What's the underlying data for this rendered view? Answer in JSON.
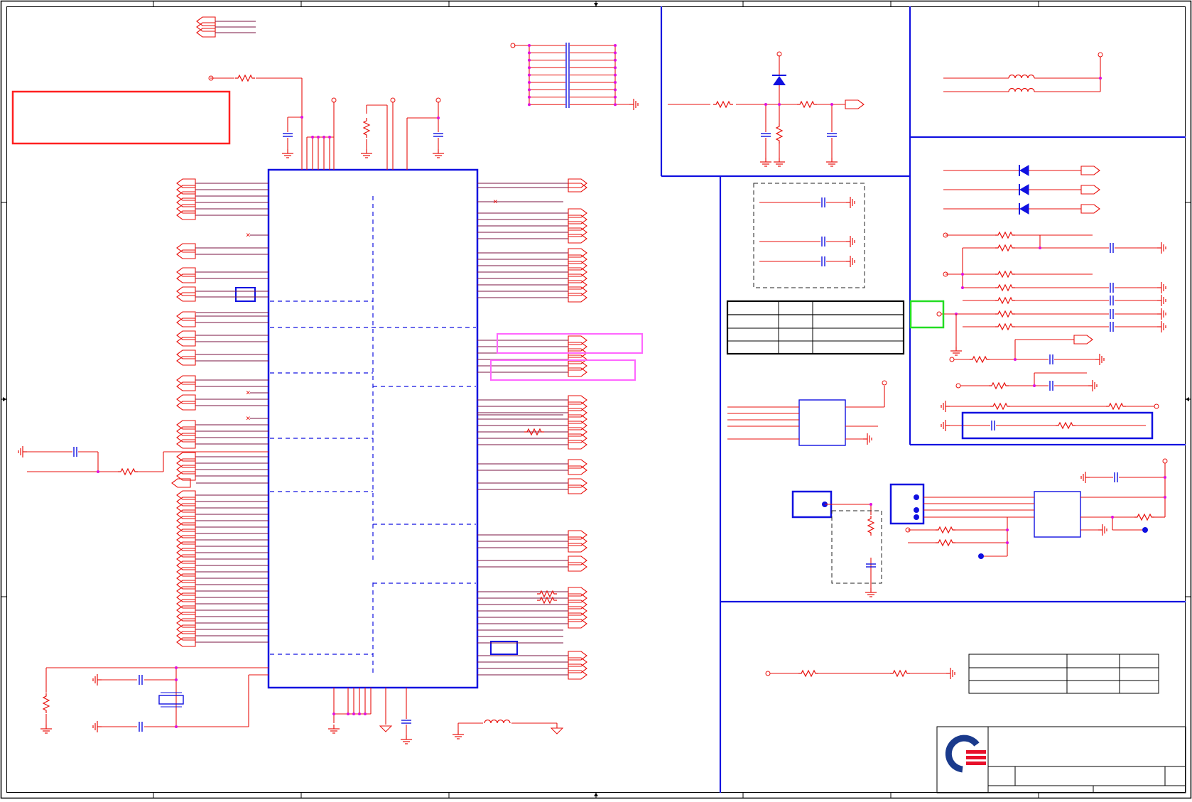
{
  "colors": {
    "wire": "#e8100c",
    "net": "#7a1340",
    "box": "#1010e0",
    "junction": "#e010e0",
    "highlight_red": "#ff2020",
    "highlight_magenta": "#ff66ff",
    "highlight_green": "#22dd22",
    "dashed": "#222222",
    "logo_blue": "#1a3a8c",
    "logo_red": "#e8102a"
  },
  "title_block": {
    "logo_icon": "quanta-logo-icon"
  },
  "icons": {
    "ground": "ground-icon",
    "resistor": "resistor-icon",
    "capacitor": "capacitor-icon",
    "inductor": "inductor-icon",
    "diode": "diode-icon",
    "crystal": "crystal-icon",
    "off_page_connector": "off-page-connector-icon"
  }
}
